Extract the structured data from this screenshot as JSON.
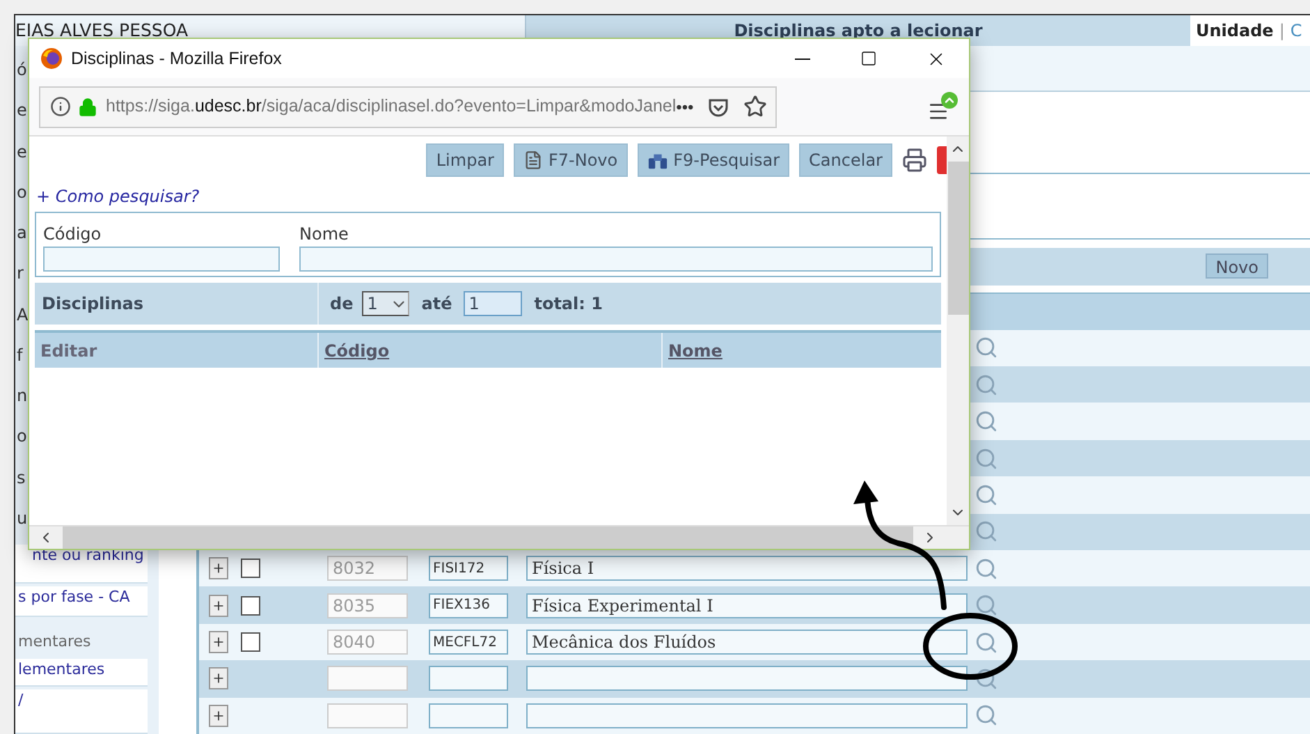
{
  "page_header": {
    "user_name": "EIAS ALVES PESSOA",
    "title": "Disciplinas apto a lecionar",
    "tab": "Unidade",
    "tab_separator": "|",
    "tab_next": "C"
  },
  "sidebar": {
    "items": [
      {
        "kind": "cut",
        "text": "ó"
      },
      {
        "kind": "cut",
        "text": "e"
      },
      {
        "kind": "cut",
        "text": "e"
      },
      {
        "kind": "cut",
        "text": "o"
      },
      {
        "kind": "cut",
        "text": "a"
      },
      {
        "kind": "cut",
        "text": "r"
      },
      {
        "kind": "cut",
        "text": "A"
      },
      {
        "kind": "cut",
        "text": "f"
      },
      {
        "kind": "cut",
        "text": "n"
      },
      {
        "kind": "cut",
        "text": "o"
      },
      {
        "kind": "cut",
        "text": "s"
      },
      {
        "kind": "cut",
        "text": "u"
      },
      {
        "kind": "link",
        "text": "nte ou ranking"
      },
      {
        "kind": "link",
        "text": "s por fase - CA"
      },
      {
        "kind": "heading",
        "text": "mentares"
      },
      {
        "kind": "link",
        "text": "lementares"
      },
      {
        "kind": "link",
        "text": "/"
      }
    ]
  },
  "table": {
    "toolbar_button": "Novo",
    "rows": [
      {
        "kind": "covered"
      },
      {
        "kind": "covered"
      },
      {
        "kind": "covered"
      },
      {
        "kind": "covered"
      },
      {
        "kind": "covered"
      },
      {
        "kind": "covered"
      },
      {
        "kind": "filled",
        "checked": false,
        "id": "8032",
        "code": "FISI172",
        "name": "Física I"
      },
      {
        "kind": "filled",
        "checked": false,
        "id": "8035",
        "code": "FIEX136",
        "name": "Física Experimental I"
      },
      {
        "kind": "filled",
        "checked": false,
        "id": "8040",
        "code": "MECFL72",
        "name": "Mecânica dos Fluídos"
      },
      {
        "kind": "empty"
      },
      {
        "kind": "empty"
      }
    ]
  },
  "popup": {
    "title": "Disciplinas - Mozilla Firefox",
    "url": "https://siga.**udesc.br**/siga/aca/disciplinasel.do?evento=Limpar&modoJanel",
    "more": "•••",
    "toolbar": [
      {
        "kind": "clear",
        "label": "Limpar"
      },
      {
        "kind": "new",
        "label": "F7-Novo"
      },
      {
        "kind": "search",
        "label": "F9-Pesquisar"
      },
      {
        "kind": "cancel",
        "label": "Cancelar"
      }
    ],
    "help_link": "+ Como pesquisar?",
    "search_fields": [
      {
        "label": "Código"
      },
      {
        "label": "Nome"
      }
    ],
    "pager": {
      "title": "Disciplinas",
      "from_label": "de",
      "from_value": "1",
      "to_label": "até",
      "to_value": "1",
      "total": "total: 1"
    },
    "columns": [
      "Editar",
      "Código",
      "Nome"
    ]
  }
}
